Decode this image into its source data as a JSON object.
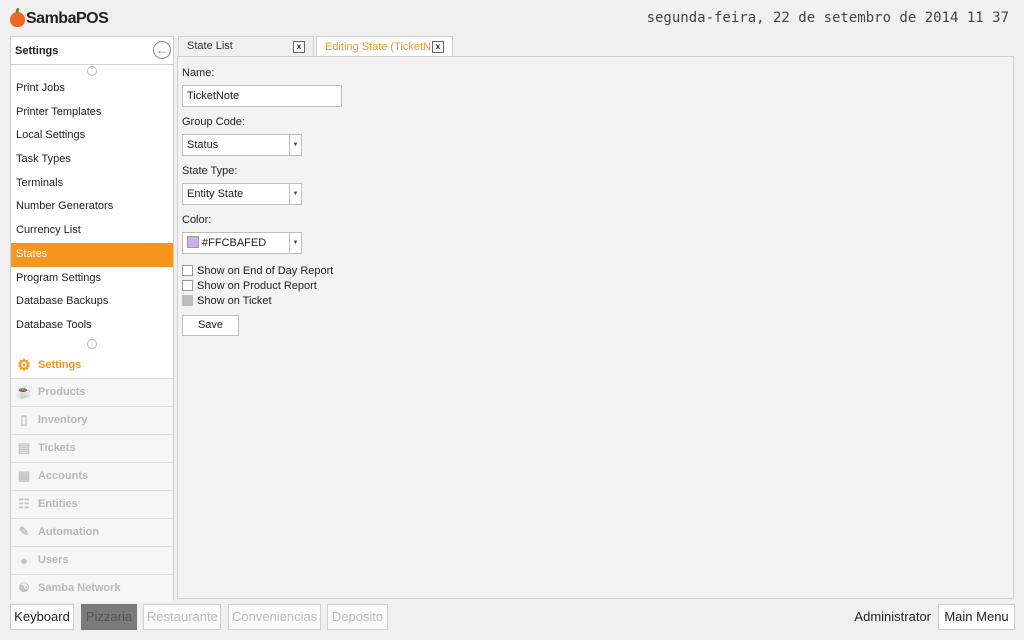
{
  "app": {
    "name": "SambaPOS",
    "datetime": "segunda-feira, 22 de setembro de 2014 11 37"
  },
  "sidebar": {
    "title": "Settings",
    "items": [
      {
        "label": "Print Jobs",
        "active": false
      },
      {
        "label": "Printer Templates",
        "active": false
      },
      {
        "label": "Local Settings",
        "active": false
      },
      {
        "label": "Task Types",
        "active": false
      },
      {
        "label": "Terminals",
        "active": false
      },
      {
        "label": "Number Generators",
        "active": false
      },
      {
        "label": "Currency List",
        "active": false
      },
      {
        "label": "States",
        "active": true
      },
      {
        "label": "Program Settings",
        "active": false
      },
      {
        "label": "Database Backups",
        "active": false
      },
      {
        "label": "Database Tools",
        "active": false
      }
    ],
    "sections": [
      {
        "label": "Settings",
        "icon": "gear-icon",
        "active": true
      },
      {
        "label": "Products",
        "icon": "cup-icon"
      },
      {
        "label": "Inventory",
        "icon": "box-icon"
      },
      {
        "label": "Tickets",
        "icon": "books-icon"
      },
      {
        "label": "Accounts",
        "icon": "calculator-icon"
      },
      {
        "label": "Entities",
        "icon": "grid-icon"
      },
      {
        "label": "Automation",
        "icon": "pen-icon"
      },
      {
        "label": "Users",
        "icon": "user-icon"
      },
      {
        "label": "Samba Network",
        "icon": "globe-icon"
      }
    ]
  },
  "tabs": [
    {
      "label": "State List",
      "close": "x",
      "active": false
    },
    {
      "label": "Editing State (TicketN",
      "close": "x",
      "active": true
    }
  ],
  "form": {
    "name_label": "Name:",
    "name_value": "TicketNote",
    "group_code_label": "Group Code:",
    "group_code_value": "Status",
    "state_type_label": "State Type:",
    "state_type_value": "Entity State",
    "color_label": "Color:",
    "color_value": "#FFCBAFED",
    "swatch_color": "#cbafed",
    "checkboxes": [
      {
        "label": "Show on End of Day Report",
        "checked": false
      },
      {
        "label": "Show on Product Report",
        "checked": false
      },
      {
        "label": "Show on Ticket",
        "checked": false,
        "disabled": true
      }
    ],
    "save_label": "Save"
  },
  "bottom": {
    "keyboard_label": "Keyboard",
    "departments": [
      {
        "label": "Pizzaria",
        "selected": true
      },
      {
        "label": "Restaurante"
      },
      {
        "label": "Conveniencias"
      },
      {
        "label": "Deposito"
      }
    ],
    "user": "Administrator",
    "main_menu_label": "Main Menu"
  },
  "colors": {
    "accent": "#f7941d",
    "brand": "#f26522"
  }
}
